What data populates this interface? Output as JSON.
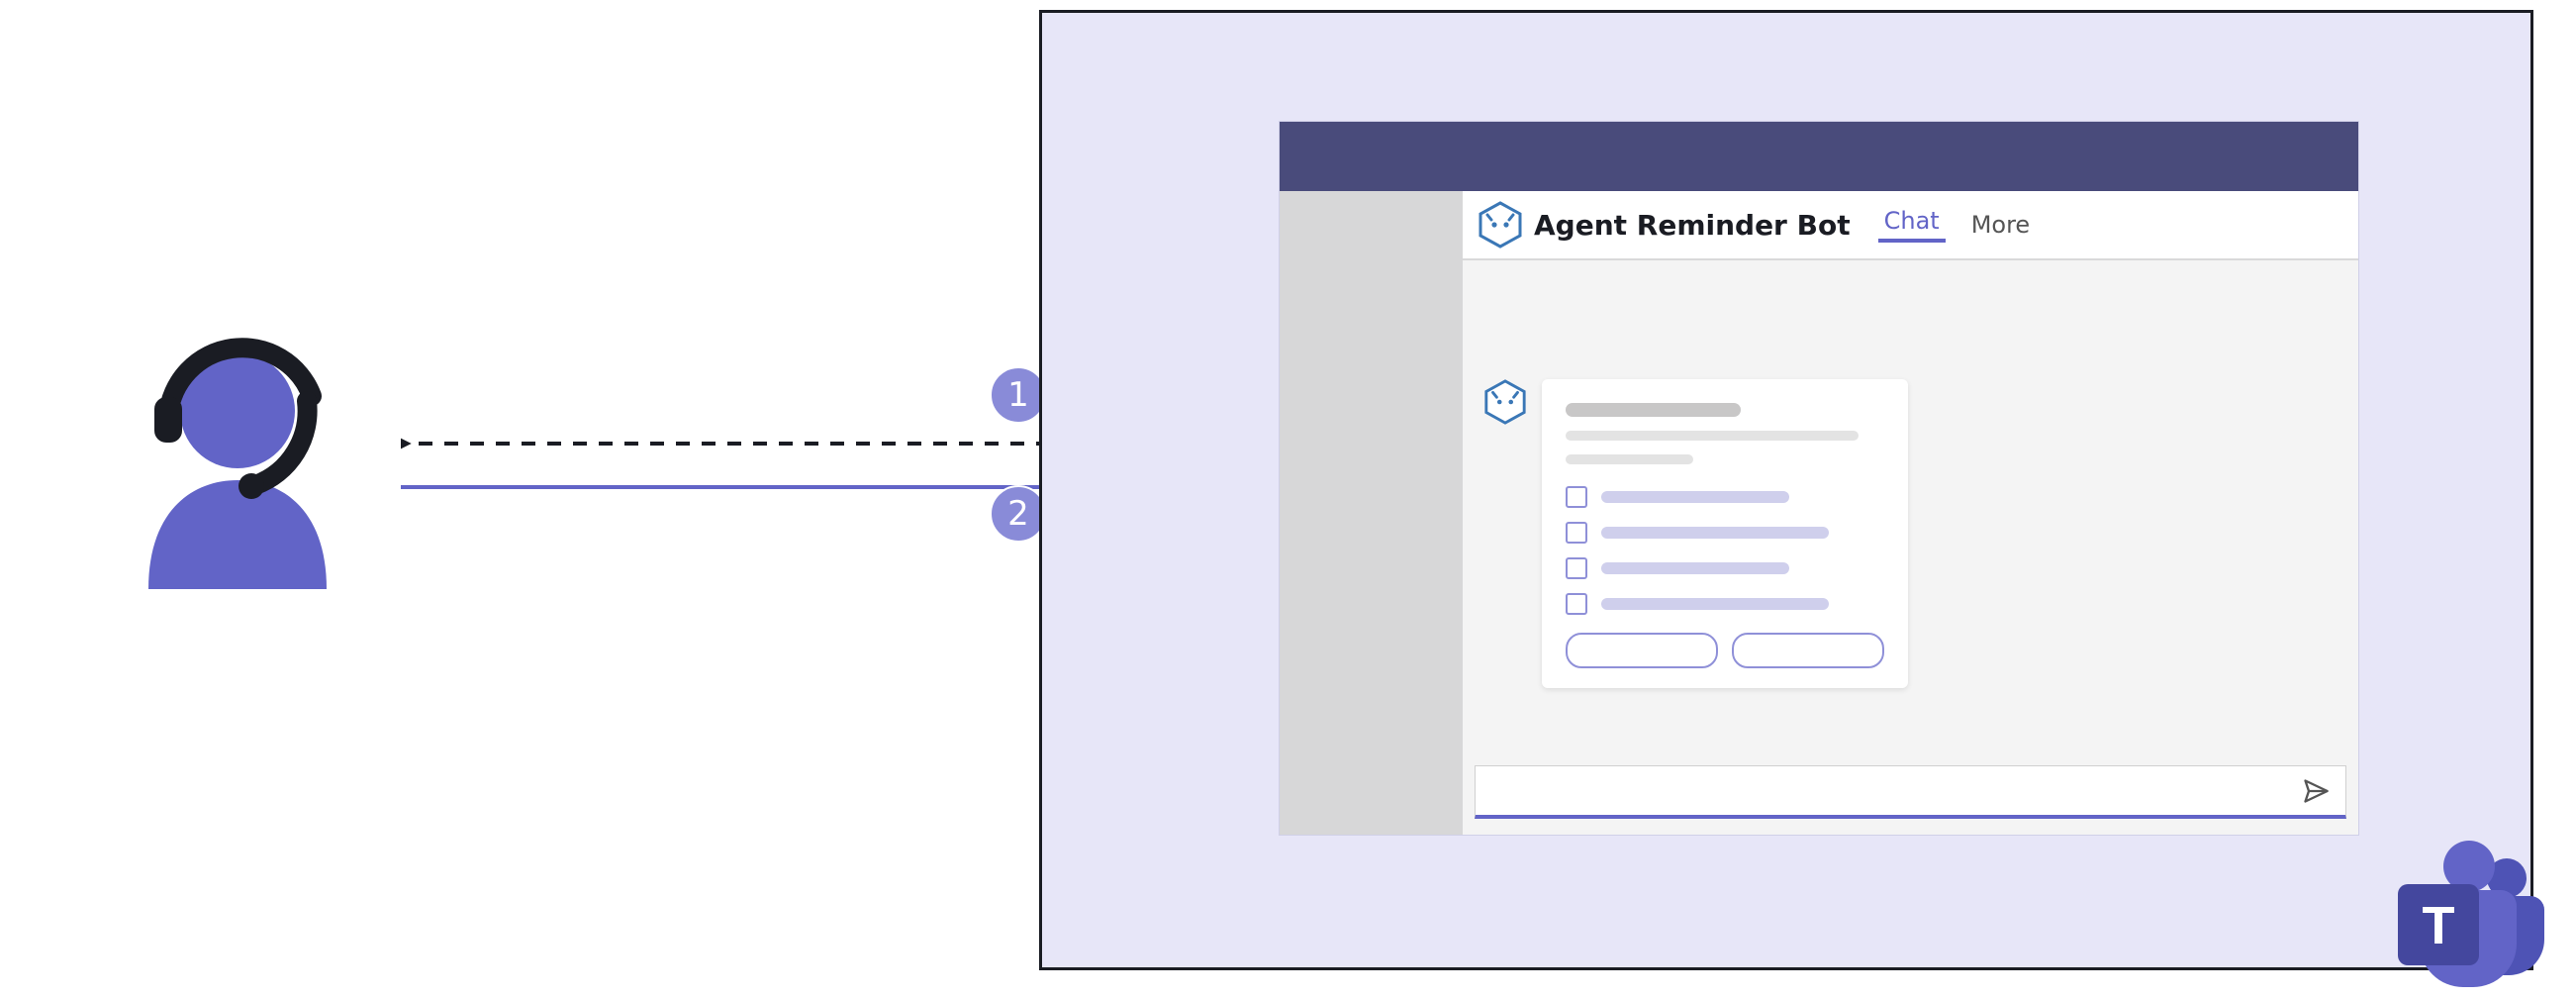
{
  "steps": {
    "first": "1",
    "second": "2"
  },
  "entities": {
    "agent_icon": "headset-user-icon",
    "bot_icon": "bot-cube-icon"
  },
  "arrows": {
    "to_agent_style": "dashed",
    "to_bot_style": "solid"
  },
  "teams_window": {
    "header": {
      "app_name": "Agent Reminder Bot",
      "tabs": [
        {
          "label": "Chat",
          "selected": true
        },
        {
          "label": "More",
          "selected": false
        }
      ]
    },
    "message_card": {
      "checklist_item_count": 4,
      "action_button_count": 2
    },
    "composer": {
      "send_icon": "send-icon"
    },
    "product_logo": "microsoft-teams"
  },
  "colors": {
    "panel_bg": "#E7E6F8",
    "teams_title_bar": "#494B7B",
    "accent": "#6264C7",
    "step_badge": "#898BD8",
    "bot_primary": "#32BEDD",
    "bot_secondary": "#198AB3"
  }
}
